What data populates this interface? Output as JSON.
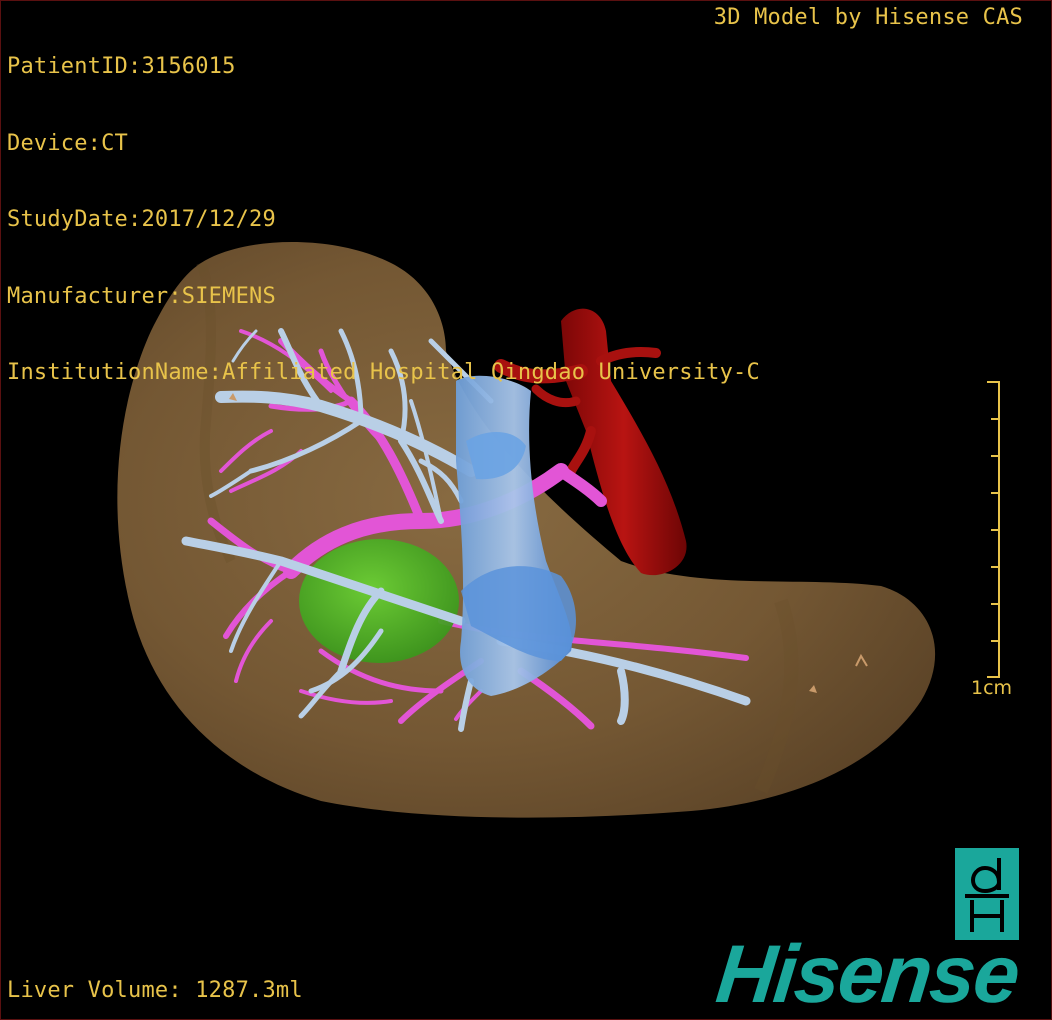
{
  "study_info": {
    "patient_id": "PatientID:3156015",
    "device": "Device:CT",
    "study_date": "StudyDate:2017/12/29",
    "manufacturer": "Manufacturer:SIEMENS",
    "institution": "InstitutionName:Affiliated Hospital Qingdao University-C"
  },
  "model_credit": "3D Model by Hisense CAS",
  "liver_volume": "Liver Volume: 1287.3ml",
  "scale": {
    "label": "1cm"
  },
  "logo": {
    "wordmark": "Hisense",
    "mark_icon": "dH-monogram-icon"
  },
  "colors": {
    "overlay_text": "#e8c34a",
    "liver": "#8a6a3e",
    "hepatic_vein": "#b9cfe6",
    "portal_vein": "#e255d6",
    "inferior_vena_cava": "#5d98e0",
    "aorta": "#b0100e",
    "gallbladder_tumor": "#4fb82a",
    "brand": "#1aa79b"
  },
  "structures": [
    "liver",
    "hepatic-veins",
    "portal-veins",
    "inferior-vena-cava",
    "aorta",
    "green-lesion"
  ]
}
